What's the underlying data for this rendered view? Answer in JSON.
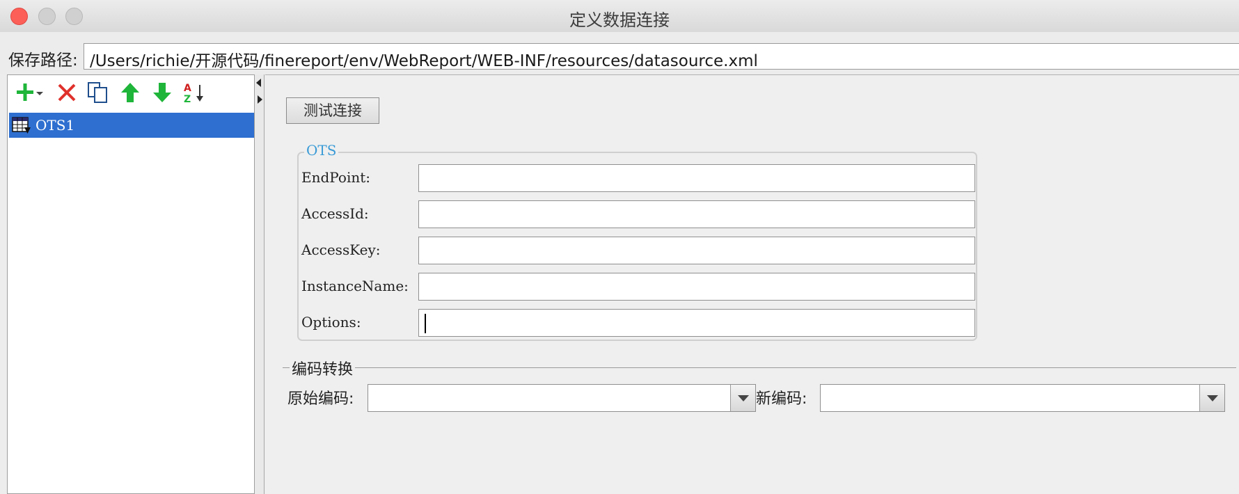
{
  "window": {
    "title": "定义数据连接"
  },
  "path": {
    "label": "保存路径:",
    "value": "/Users/richie/开源代码/finereport/env/WebReport/WEB-INF/resources/datasource.xml"
  },
  "toolbar": {
    "add_icon": "plus-icon",
    "delete_icon": "close-icon",
    "copy_icon": "copy-icon",
    "up_icon": "arrow-up-icon",
    "down_icon": "arrow-down-icon",
    "sort_icon": "sort-icon",
    "colors": {
      "green": "#1fb53a",
      "red": "#e0312b",
      "blue": "#1e4e8c"
    }
  },
  "tree": {
    "items": [
      {
        "label": "OTS1",
        "selected": true,
        "icon": "table-icon"
      }
    ]
  },
  "main": {
    "test_button": "测试连接",
    "group": {
      "title": "OTS",
      "fields": [
        {
          "label": "EndPoint:",
          "value": ""
        },
        {
          "label": "AccessId:",
          "value": ""
        },
        {
          "label": "AccessKey:",
          "value": ""
        },
        {
          "label": "InstanceName:",
          "value": ""
        },
        {
          "label": "Options:",
          "value": ""
        }
      ]
    },
    "encoding": {
      "title": "编码转换",
      "original_label": "原始编码:",
      "original_value": "",
      "new_label": "新编码:",
      "new_value": ""
    }
  },
  "colors": {
    "selection": "#2e6fd0",
    "group_title": "#3a9bd6",
    "close_light": "#fc5f57"
  }
}
